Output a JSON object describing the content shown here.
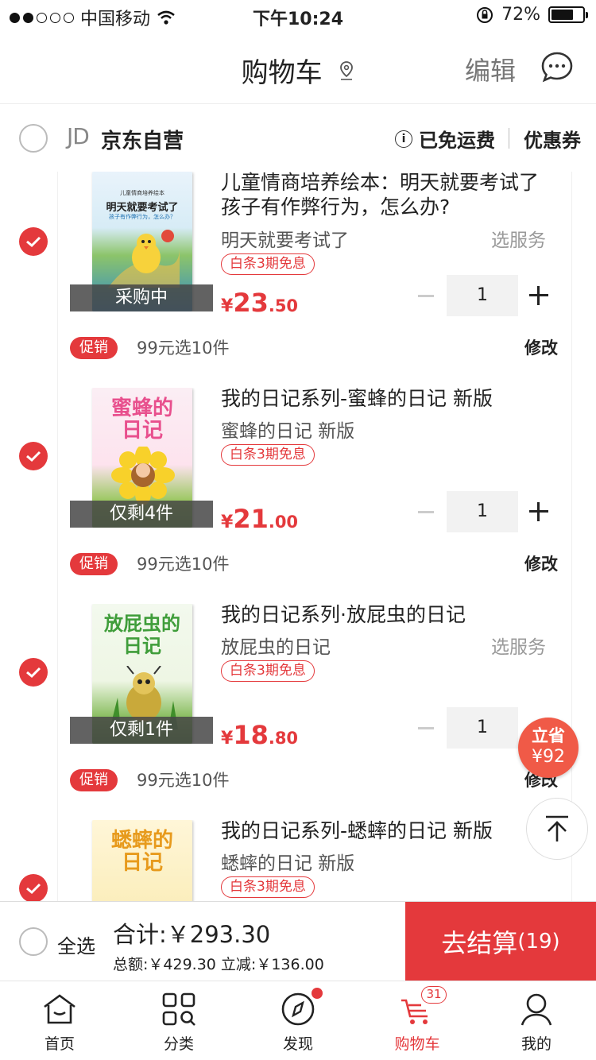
{
  "status_bar": {
    "carrier": "中国移动",
    "time": "下午10:24",
    "battery": "72%",
    "battery_level": 0.72
  },
  "header": {
    "title": "购物车",
    "edit_label": "编辑"
  },
  "shop": {
    "logo_text": "JD",
    "name": "京东自营",
    "free_shipping": "已免运费",
    "coupon": "优惠券"
  },
  "items": [
    {
      "name": "儿童情商培养绘本：明天就要考试了 孩子有作弊行为，怎么办?",
      "spec": "明天就要考试了",
      "service": "选服务",
      "baitiao": "白条3期免息",
      "price_symbol": "¥",
      "price_int": "23",
      "price_dec": ".50",
      "qty": "1",
      "overlay": "采购中",
      "cover_title": "明天就要考试了",
      "cover_sub": "孩子有作弊行为，怎么办？",
      "cover_top": "儿童情商培养绘本"
    },
    {
      "name": "我的日记系列-蜜蜂的日记 新版",
      "spec": "蜜蜂的日记 新版",
      "baitiao": "白条3期免息",
      "price_symbol": "¥",
      "price_int": "21",
      "price_dec": ".00",
      "qty": "1",
      "overlay": "仅剩4件",
      "cover_title_1": "蜜蜂的",
      "cover_title_2": "日记"
    },
    {
      "name": "我的日记系列·放屁虫的日记",
      "spec": "放屁虫的日记",
      "service": "选服务",
      "baitiao": "白条3期免息",
      "price_symbol": "¥",
      "price_int": "18",
      "price_dec": ".80",
      "qty": "1",
      "overlay": "仅剩1件",
      "cover_title_1": "放屁虫的",
      "cover_title_2": "日记"
    },
    {
      "name": "我的日记系列-蟋蟀的日记 新版",
      "spec": "蟋蟀的日记 新版",
      "baitiao": "白条3期免息",
      "cover_title_1": "蟋蟀的",
      "cover_title_2": "日记"
    }
  ],
  "promo": {
    "tag": "促销",
    "text": "99元选10件",
    "edit": "修改"
  },
  "save_badge": {
    "line1": "立省",
    "line2": "¥92"
  },
  "checkout": {
    "select_all": "全选",
    "total": "合计:￥293.30",
    "subtotal": "总额:￥429.30 立减:￥136.00",
    "pay_label": "去结算",
    "pay_count": "(19)"
  },
  "tabs": [
    {
      "label": "首页",
      "icon": "home-icon"
    },
    {
      "label": "分类",
      "icon": "category-icon"
    },
    {
      "label": "发现",
      "icon": "discover-icon"
    },
    {
      "label": "购物车",
      "icon": "cart-icon",
      "badge": "31"
    },
    {
      "label": "我的",
      "icon": "profile-icon"
    }
  ],
  "colors": {
    "accent": "#e4393c",
    "badge": "#f05a47"
  }
}
